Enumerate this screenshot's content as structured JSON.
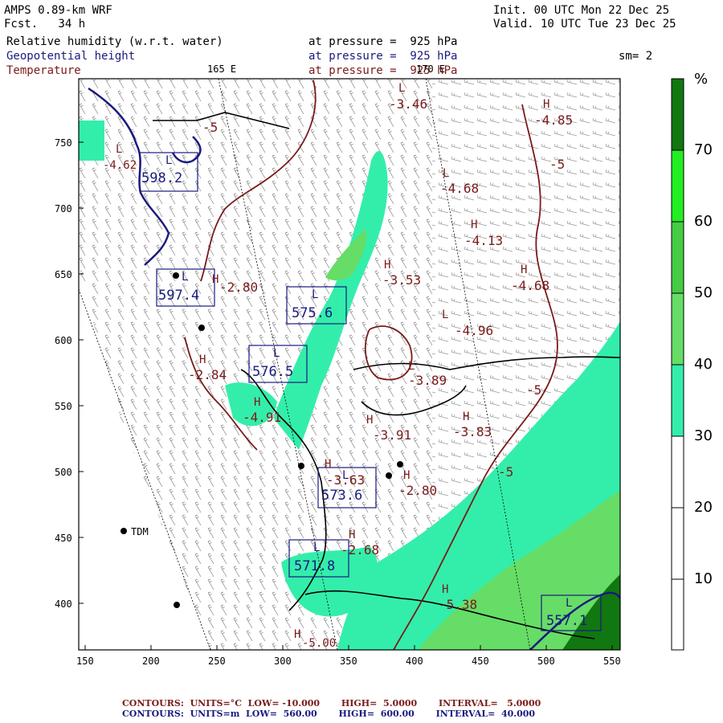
{
  "header": {
    "model": "AMPS 0.89-km WRF",
    "forecast": "Fcst.   34 h",
    "init": "Init. 00 UTC Mon 22 Dec 25",
    "valid": "Valid. 10 UTC Tue 23 Dec 25",
    "fields": [
      {
        "name": "Relative humidity (w.r.t. water)",
        "level": "at pressure =  925 hPa"
      },
      {
        "name": "Geopotential height",
        "level": "at pressure =  925 hPa"
      },
      {
        "name": "Temperature",
        "level": "at pressure =  925 hPa"
      }
    ],
    "smoothing": "sm= 2",
    "meridian_labels": [
      "165 E",
      "170 E"
    ]
  },
  "colors": {
    "rh": "#ffffff",
    "rh_30": "#33eeaa",
    "rh_40": "#66dd66",
    "rh_50": "#44cc44",
    "rh_60": "#22ee22",
    "rh_70": "#117711",
    "height_contour": "#1a1a80",
    "temp_contour": "#7a1a1a"
  },
  "colorbar": {
    "unit": "%",
    "labels": [
      "70",
      "60",
      "50",
      "40",
      "30",
      "20",
      "10"
    ]
  },
  "axes": {
    "x_ticks": [
      "150",
      "200",
      "250",
      "300",
      "350",
      "400",
      "450",
      "500",
      "550"
    ],
    "y_ticks": [
      "750",
      "700",
      "650",
      "600",
      "550",
      "500",
      "450",
      "400"
    ]
  },
  "stations": [
    {
      "label": "TDM"
    }
  ],
  "height_boxes": [
    {
      "label": "598.2",
      "hl": "L"
    },
    {
      "label": "597.4",
      "hl": "L"
    },
    {
      "label": "575.6",
      "hl": "L"
    },
    {
      "label": "576.5",
      "hl": "L"
    },
    {
      "label": "573.6",
      "hl": "L"
    },
    {
      "label": "571.8",
      "hl": "L"
    },
    {
      "label": "557.1",
      "hl": "L"
    }
  ],
  "temp_labels": [
    {
      "hl": "L",
      "value": "-3.46"
    },
    {
      "hl": "H",
      "value": "-4.85"
    },
    {
      "hl": "L",
      "value": "-4.68"
    },
    {
      "hl": "H",
      "value": "-4.13"
    },
    {
      "hl": "H",
      "value": "-3.53"
    },
    {
      "hl": "H",
      "value": "-4.68"
    },
    {
      "hl": "L",
      "value": "-4.96"
    },
    {
      "hl": "L",
      "value": "-3.89"
    },
    {
      "hl": "H",
      "value": "-3.83"
    },
    {
      "hl": "H",
      "value": "-2.80"
    },
    {
      "hl": "H",
      "value": "-2.84"
    },
    {
      "hl": "H",
      "value": "-4.91"
    },
    {
      "hl": "H",
      "value": "-3.91"
    },
    {
      "hl": "H",
      "value": "-3.63"
    },
    {
      "hl": "H",
      "value": "-2.80"
    },
    {
      "hl": "H",
      "value": "-2.68"
    },
    {
      "hl": "H",
      "value": "-5.38"
    },
    {
      "hl": "H",
      "value": "-5.00"
    },
    {
      "hl": "L",
      "value": "-4.62"
    }
  ],
  "contour_labels": [
    "-5",
    "-5",
    "-5",
    "-5"
  ],
  "footer": {
    "temp": {
      "label": "CONTOURS:",
      "units": "UNITS=°C",
      "low": "LOW= -10.000",
      "high": "HIGH=  5.0000",
      "interval": "INTERVAL=   5.0000"
    },
    "height": {
      "label": "CONTOURS:",
      "units": "UNITS=m",
      "low": "LOW=  560.00",
      "high": "HIGH=  600.00",
      "interval": "INTERVAL=  40.000"
    }
  }
}
